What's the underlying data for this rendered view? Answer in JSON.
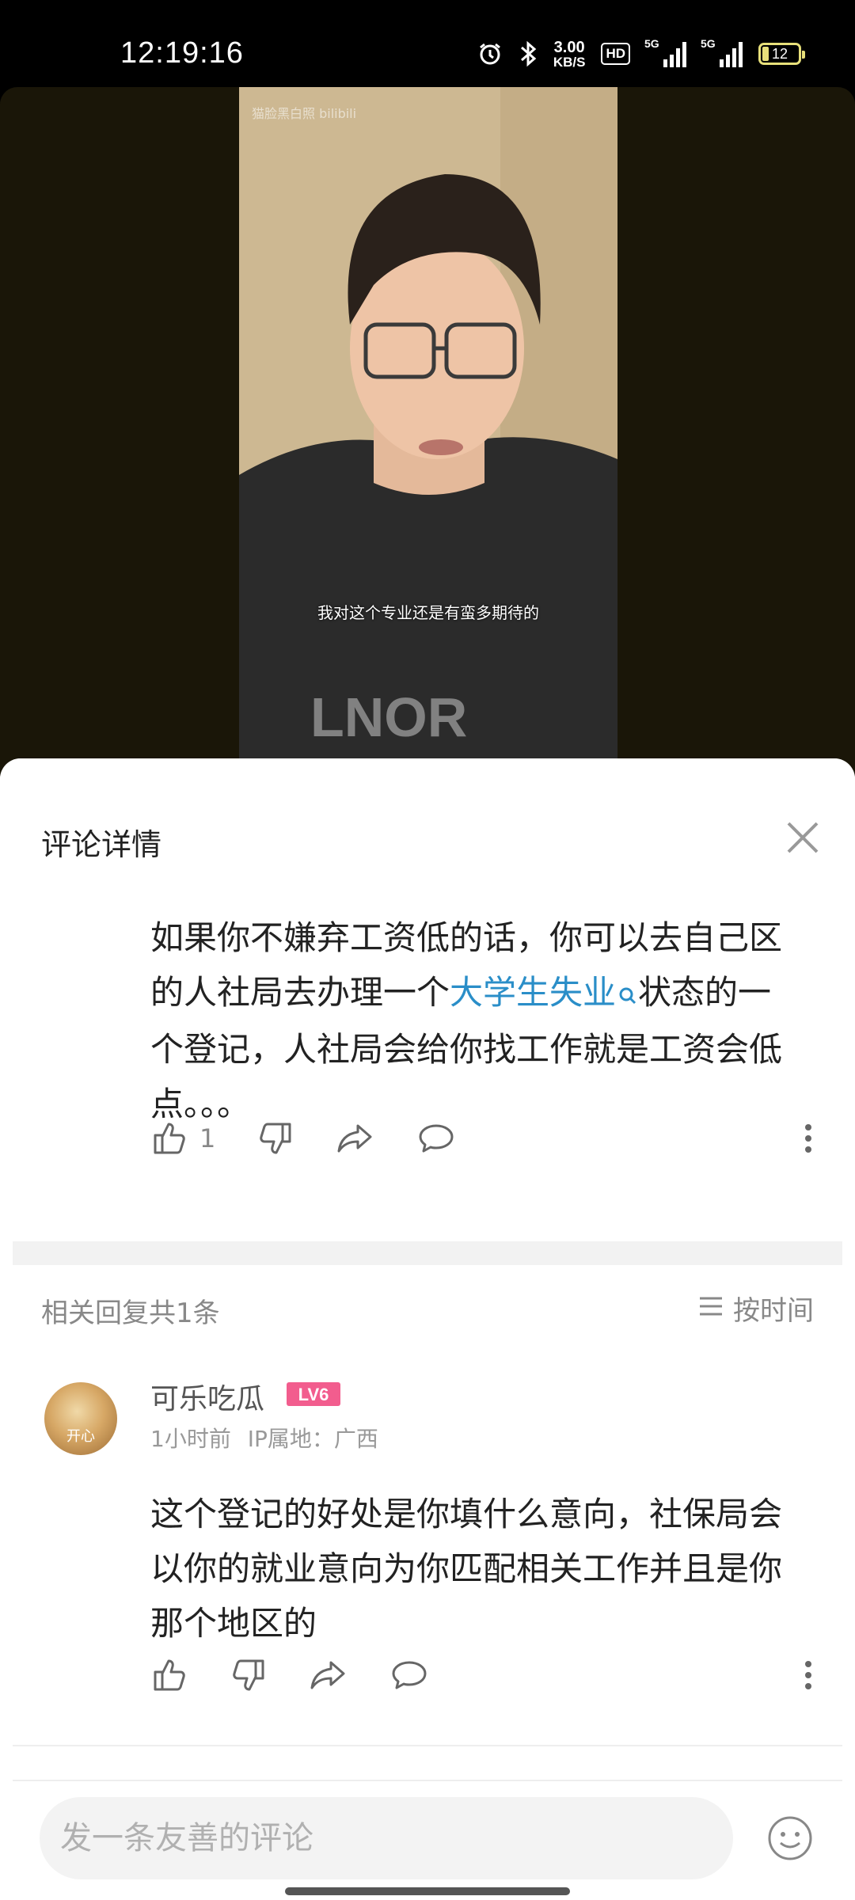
{
  "status_bar": {
    "time": "12:19:16",
    "net_speed_value": "3.00",
    "net_speed_unit": "KB/S",
    "hd_badge": "HD",
    "signal1_label": "5G",
    "signal2_label": "5G",
    "battery_level": "12",
    "icons": [
      "alarm-icon",
      "bluetooth-icon",
      "signal-icon",
      "battery-icon"
    ]
  },
  "video": {
    "watermark": "猫脸黑白照 bilibili",
    "subtitle": "我对这个专业还是有蛮多期待的"
  },
  "sheet": {
    "title": "评论详情",
    "close_icon": "close-icon"
  },
  "parent_comment": {
    "text_before": "如果你不嫌弃工资低的话，你可以去自己区的人社局去办理一个",
    "keyword": "大学生失业",
    "text_after": "状态的一个登记，人社局会给你找工作就是工资会低点。。。",
    "like_count": "1"
  },
  "related": {
    "label": "相关回复共1条",
    "sort_label": "按时间"
  },
  "reply": {
    "username": "可乐吃瓜",
    "level": "LV6",
    "avatar_text": "开心",
    "time": "1小时前",
    "ip_label": "IP属地：广西",
    "text": "这个登记的好处是你填什么意向，社保局会以你的就业意向为你匹配相关工作并且是你那个地区的"
  },
  "input": {
    "placeholder": "发一条友善的评论"
  },
  "colors": {
    "keyword": "#2a8ec8",
    "level_badge": "#f25d8e",
    "battery": "#e8e07a"
  }
}
